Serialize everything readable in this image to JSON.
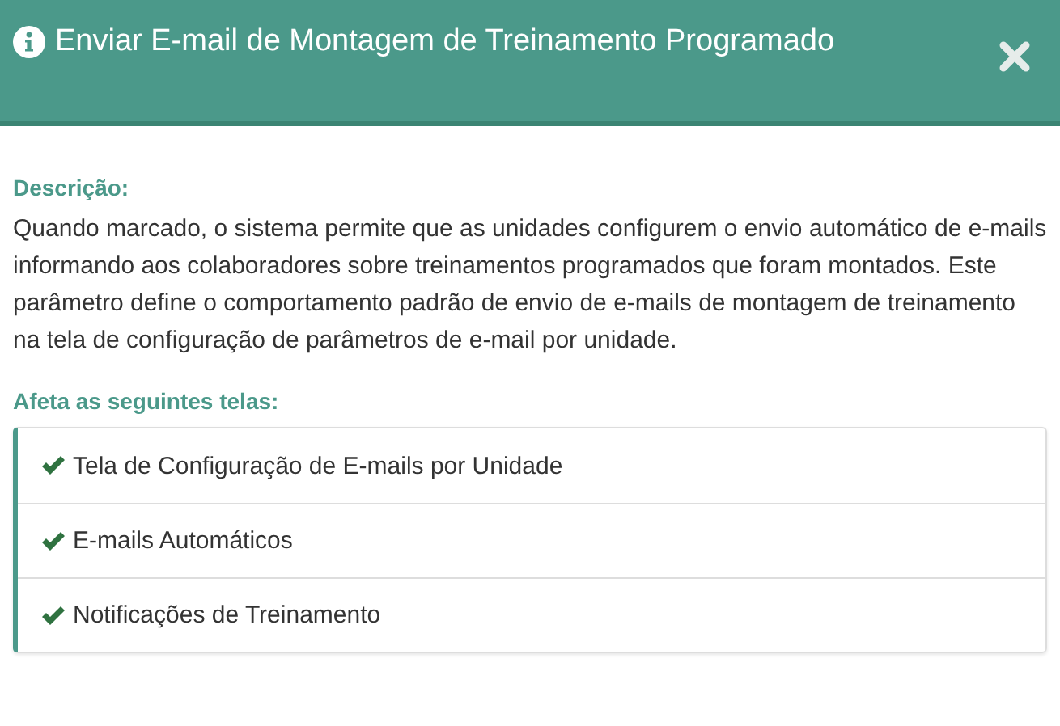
{
  "dialog": {
    "title": "Enviar E-mail de Montagem de Treinamento Programado"
  },
  "description": {
    "label": "Descrição:",
    "text": "Quando marcado, o sistema permite que as unidades configurem o envio automático de e-mails informando aos colaboradores sobre treinamentos programados que foram montados. Este parâmetro define o comportamento padrão de envio de e-mails de montagem de treinamento na tela de configuração de parâmetros de e-mail por unidade."
  },
  "affected": {
    "label": "Afeta as seguintes telas:",
    "items": [
      {
        "label": "Tela de Configuração de E-mails por Unidade"
      },
      {
        "label": "E-mails Automáticos"
      },
      {
        "label": "Notificações de Treinamento"
      }
    ]
  }
}
